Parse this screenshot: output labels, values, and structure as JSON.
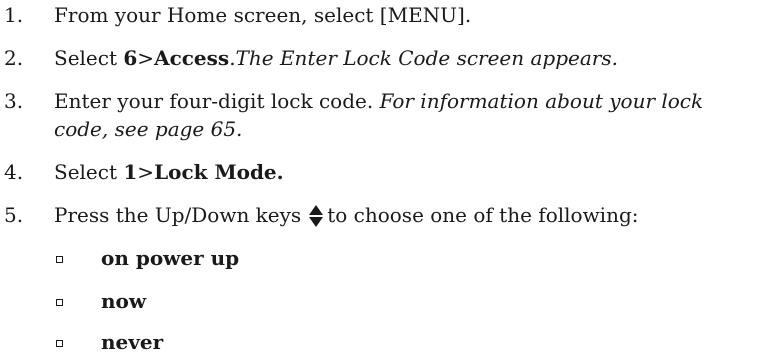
{
  "steps": [
    {
      "num": "1.",
      "text": "From your Home screen, select [MENU]."
    },
    {
      "num": "2.",
      "pre": "Select ",
      "bold1": "6",
      "mid": ">",
      "bold2": "Access",
      "post": ".",
      "italic": "The Enter Lock Code screen appears."
    },
    {
      "num": "3.",
      "pre": "Enter your four-digit lock code. ",
      "italic1": "For information about your lock",
      "italic2": "code, see page 65."
    },
    {
      "num": "4.",
      "pre": "Select ",
      "bold1": "1",
      "mid": ">",
      "bold2": "Lock Mode."
    },
    {
      "num": "5.",
      "pre": "Press the Up/Down keys",
      "post": "to choose one of the following:",
      "icon": "up-down-arrows-icon"
    }
  ],
  "options": [
    "on power up",
    "now",
    "never"
  ]
}
